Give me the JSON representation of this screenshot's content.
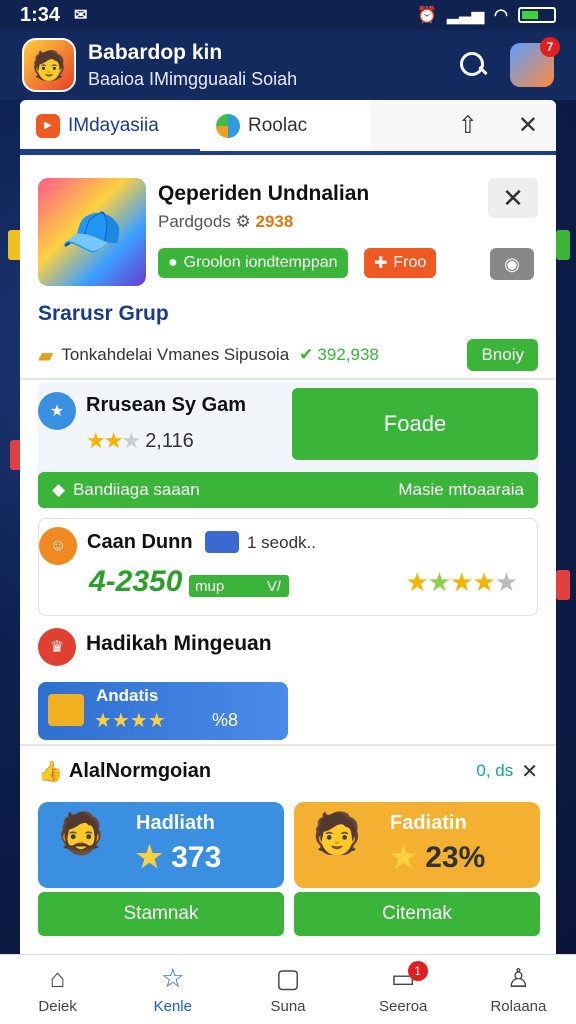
{
  "status": {
    "time": "1:34"
  },
  "header": {
    "title": "Babardop kin",
    "subtitle": "Baaioa IMimgguaali Soiah",
    "notif_count": "7"
  },
  "tabs": [
    {
      "label": "IMdayasiia"
    },
    {
      "label": "Roolac"
    }
  ],
  "game": {
    "title": "Qeperiden Undnalian",
    "sub_prefix": "Pardgods",
    "sub_value": "2938",
    "tag_green": "Groolon iondtemppan",
    "tag_orange": "Froo"
  },
  "group": {
    "title": "Srarusr Grup",
    "row_text": "Tonkahdelai Vmanes Sipusoia",
    "count": "392,938",
    "button": "Bnoiy"
  },
  "game_card": {
    "title": "Rrusean Sy Gam",
    "rating": "2,116",
    "play_button": "Foade",
    "banner_left": "Bandiiaga saaan",
    "banner_right": "Masie mtoaaraia"
  },
  "user_card": {
    "name": "Caan Dunn",
    "meta": "1 seodk..",
    "score": "4-2350",
    "mup": "mup",
    "v": "V/"
  },
  "weekly": {
    "title": "Hadikah Mingeuan",
    "tile_label": "Andatis",
    "tile_value": "%8"
  },
  "notice": {
    "title": "AlalNormgoian",
    "right": "0, ds"
  },
  "rewards": [
    {
      "title": "Hadliath",
      "value": "373",
      "button": "Stamnak",
      "color": "#3a8fe0"
    },
    {
      "title": "Fadiatin",
      "value": "23%",
      "button": "Citemak",
      "color": "#f4b030"
    }
  ],
  "nav": [
    {
      "label": "Deiek"
    },
    {
      "label": "Kenle"
    },
    {
      "label": "Suna"
    },
    {
      "label": "Seeroa",
      "badge": "1"
    },
    {
      "label": "Rolaana"
    }
  ]
}
